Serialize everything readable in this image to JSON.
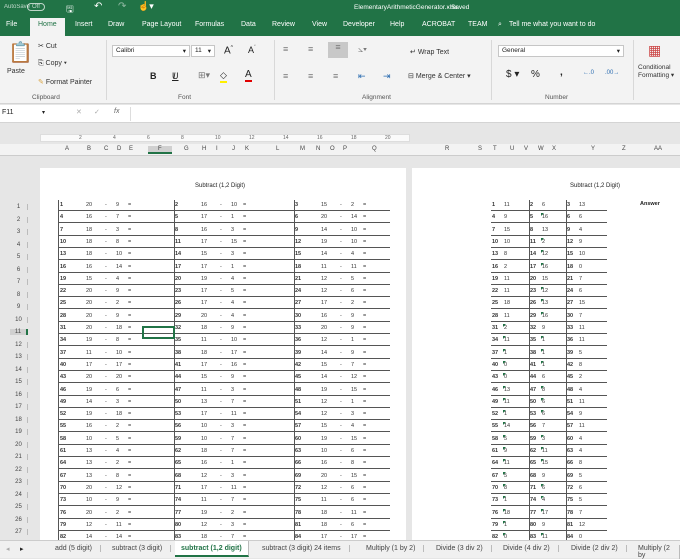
{
  "titlebar": {
    "autosave": "AutoSave",
    "autosave_state": "Off",
    "filename": "ElementaryArithmeticGenerator.xlsx",
    "status": "Saved"
  },
  "tabs": [
    "File",
    "Home",
    "Insert",
    "Draw",
    "Page Layout",
    "Formulas",
    "Data",
    "Review",
    "View",
    "Developer",
    "Help",
    "ACROBAT",
    "TEAM"
  ],
  "tell_me": "Tell me what you want to do",
  "ribbon": {
    "paste": "Paste",
    "cut": "Cut",
    "copy": "Copy",
    "format_painter": "Format Painter",
    "clipboard": "Clipboard",
    "font_name": "Calibri",
    "font_size": "11",
    "font": "Font",
    "bold": "B",
    "italic": "I",
    "underline": "U",
    "wrap_text": "Wrap Text",
    "merge_center": "Merge & Center",
    "alignment": "Alignment",
    "number_format": "General",
    "currency": "$",
    "percent": "%",
    "comma": ",",
    "number": "Number",
    "conditional": "Conditional",
    "formatting": "Formatting"
  },
  "formula_bar": {
    "name_box": "F11",
    "fx": "fx",
    "value": ""
  },
  "ruler_ticks": [
    "2",
    "4",
    "6",
    "8",
    "10",
    "12",
    "14",
    "16",
    "18",
    "20"
  ],
  "columns_left": [
    "A",
    "B",
    "C",
    "D",
    "E",
    "F",
    "G",
    "H",
    "I",
    "J",
    "K",
    "L",
    "M",
    "N",
    "O",
    "P",
    "Q"
  ],
  "columns_right": [
    "R",
    "S",
    "T",
    "U",
    "V",
    "W",
    "X",
    "Y",
    "Z",
    "AA"
  ],
  "row_numbers": [
    "1",
    "2",
    "3",
    "4",
    "5",
    "6",
    "7",
    "8",
    "9",
    "10",
    "11",
    "12",
    "13",
    "14",
    "15",
    "16",
    "17",
    "18",
    "19",
    "20",
    "21",
    "22",
    "23",
    "24",
    "25",
    "26",
    "27"
  ],
  "worksheet": {
    "title": "Subtract (1,2 Digit)",
    "answer_title": "Subtract (1,2 Digit)",
    "answer_header": "Answer",
    "minus": "-",
    "equals": "=",
    "problems": [
      [
        [
          1,
          20,
          9
        ],
        [
          2,
          16,
          10
        ],
        [
          3,
          15,
          2
        ]
      ],
      [
        [
          4,
          16,
          7
        ],
        [
          5,
          17,
          1
        ],
        [
          6,
          20,
          14
        ]
      ],
      [
        [
          7,
          18,
          3
        ],
        [
          8,
          16,
          3
        ],
        [
          9,
          14,
          10
        ]
      ],
      [
        [
          10,
          18,
          8
        ],
        [
          11,
          17,
          15
        ],
        [
          12,
          19,
          10
        ]
      ],
      [
        [
          13,
          18,
          10
        ],
        [
          14,
          15,
          3
        ],
        [
          15,
          14,
          4
        ]
      ],
      [
        [
          16,
          16,
          14
        ],
        [
          17,
          17,
          1
        ],
        [
          18,
          11,
          11
        ]
      ],
      [
        [
          19,
          15,
          4
        ],
        [
          20,
          19,
          4
        ],
        [
          21,
          12,
          5
        ]
      ],
      [
        [
          22,
          20,
          9
        ],
        [
          23,
          17,
          5
        ],
        [
          24,
          12,
          6
        ]
      ],
      [
        [
          25,
          20,
          2
        ],
        [
          26,
          17,
          4
        ],
        [
          27,
          17,
          2
        ]
      ],
      [
        [
          28,
          20,
          9
        ],
        [
          29,
          20,
          4
        ],
        [
          30,
          16,
          9
        ]
      ],
      [
        [
          31,
          20,
          18
        ],
        [
          32,
          18,
          9
        ],
        [
          33,
          20,
          9
        ]
      ],
      [
        [
          34,
          19,
          8
        ],
        [
          35,
          11,
          10
        ],
        [
          36,
          12,
          1
        ]
      ],
      [
        [
          37,
          11,
          10
        ],
        [
          38,
          18,
          17
        ],
        [
          39,
          14,
          9
        ]
      ],
      [
        [
          40,
          17,
          17
        ],
        [
          41,
          17,
          16
        ],
        [
          42,
          15,
          7
        ]
      ],
      [
        [
          43,
          20,
          20
        ],
        [
          44,
          15,
          9
        ],
        [
          45,
          14,
          12
        ]
      ],
      [
        [
          46,
          19,
          6
        ],
        [
          47,
          11,
          3
        ],
        [
          48,
          19,
          15
        ]
      ],
      [
        [
          49,
          14,
          3
        ],
        [
          50,
          13,
          7
        ],
        [
          51,
          12,
          1
        ]
      ],
      [
        [
          52,
          19,
          18
        ],
        [
          53,
          17,
          11
        ],
        [
          54,
          12,
          3
        ]
      ],
      [
        [
          55,
          16,
          2
        ],
        [
          56,
          10,
          3
        ],
        [
          57,
          15,
          4
        ]
      ],
      [
        [
          58,
          10,
          5
        ],
        [
          59,
          10,
          7
        ],
        [
          60,
          19,
          15
        ]
      ],
      [
        [
          61,
          13,
          4
        ],
        [
          62,
          18,
          7
        ],
        [
          63,
          10,
          6
        ]
      ],
      [
        [
          64,
          13,
          2
        ],
        [
          65,
          16,
          1
        ],
        [
          66,
          16,
          8
        ]
      ],
      [
        [
          67,
          13,
          8
        ],
        [
          68,
          12,
          3
        ],
        [
          69,
          20,
          15
        ]
      ],
      [
        [
          70,
          20,
          12
        ],
        [
          71,
          17,
          11
        ],
        [
          72,
          12,
          6
        ]
      ],
      [
        [
          73,
          10,
          9
        ],
        [
          74,
          11,
          7
        ],
        [
          75,
          11,
          6
        ]
      ],
      [
        [
          76,
          20,
          2
        ],
        [
          77,
          19,
          2
        ],
        [
          78,
          18,
          11
        ]
      ],
      [
        [
          79,
          12,
          11
        ],
        [
          80,
          12,
          3
        ],
        [
          81,
          18,
          6
        ]
      ],
      [
        [
          82,
          14,
          14
        ],
        [
          83,
          18,
          7
        ],
        [
          84,
          17,
          17
        ]
      ]
    ],
    "answers": [
      [
        [
          1,
          11
        ],
        [
          2,
          6
        ],
        [
          3,
          13
        ]
      ],
      [
        [
          4,
          9
        ],
        [
          5,
          16
        ],
        [
          6,
          6
        ]
      ],
      [
        [
          7,
          15
        ],
        [
          8,
          13
        ],
        [
          9,
          4
        ]
      ],
      [
        [
          10,
          10
        ],
        [
          11,
          2
        ],
        [
          12,
          9
        ]
      ],
      [
        [
          13,
          8
        ],
        [
          14,
          12
        ],
        [
          15,
          10
        ]
      ],
      [
        [
          16,
          2
        ],
        [
          17,
          16
        ],
        [
          18,
          0
        ]
      ],
      [
        [
          19,
          11
        ],
        [
          20,
          15
        ],
        [
          21,
          7
        ]
      ],
      [
        [
          22,
          11
        ],
        [
          23,
          12
        ],
        [
          24,
          6
        ]
      ],
      [
        [
          25,
          18
        ],
        [
          26,
          13
        ],
        [
          27,
          15
        ]
      ],
      [
        [
          28,
          11
        ],
        [
          29,
          16
        ],
        [
          30,
          7
        ]
      ],
      [
        [
          31,
          2
        ],
        [
          32,
          9
        ],
        [
          33,
          11
        ]
      ],
      [
        [
          34,
          11
        ],
        [
          35,
          1
        ],
        [
          36,
          11
        ]
      ],
      [
        [
          37,
          1
        ],
        [
          38,
          1
        ],
        [
          39,
          5
        ]
      ],
      [
        [
          40,
          0
        ],
        [
          41,
          1
        ],
        [
          42,
          8
        ]
      ],
      [
        [
          43,
          0
        ],
        [
          44,
          6
        ],
        [
          45,
          2
        ]
      ],
      [
        [
          46,
          13
        ],
        [
          47,
          8
        ],
        [
          48,
          4
        ]
      ],
      [
        [
          49,
          11
        ],
        [
          50,
          6
        ],
        [
          51,
          11
        ]
      ],
      [
        [
          52,
          1
        ],
        [
          53,
          6
        ],
        [
          54,
          9
        ]
      ],
      [
        [
          55,
          14
        ],
        [
          56,
          7
        ],
        [
          57,
          11
        ]
      ],
      [
        [
          58,
          5
        ],
        [
          59,
          3
        ],
        [
          60,
          4
        ]
      ],
      [
        [
          61,
          9
        ],
        [
          62,
          11
        ],
        [
          63,
          4
        ]
      ],
      [
        [
          64,
          11
        ],
        [
          65,
          15
        ],
        [
          66,
          8
        ]
      ],
      [
        [
          67,
          5
        ],
        [
          68,
          9
        ],
        [
          69,
          5
        ]
      ],
      [
        [
          70,
          8
        ],
        [
          71,
          6
        ],
        [
          72,
          6
        ]
      ],
      [
        [
          73,
          1
        ],
        [
          74,
          4
        ],
        [
          75,
          5
        ]
      ],
      [
        [
          76,
          18
        ],
        [
          77,
          17
        ],
        [
          78,
          7
        ]
      ],
      [
        [
          79,
          1
        ],
        [
          80,
          9
        ],
        [
          81,
          12
        ]
      ],
      [
        [
          82,
          0
        ],
        [
          83,
          11
        ],
        [
          84,
          0
        ]
      ]
    ]
  },
  "sheet_tabs": [
    "add (5 digit)",
    "subtract (3 digit)",
    "subtract (1,2 digit)",
    "subtract (3 digit) 24 items",
    "Multiply (1 by 2)",
    "Divide (3 div 2)",
    "Divide (4 div 2)",
    "Divide (2 div 2)",
    "Multiply (2 by"
  ],
  "active_sheet": "subtract (1,2 digit)",
  "colors": {
    "excel_green": "#217346"
  }
}
